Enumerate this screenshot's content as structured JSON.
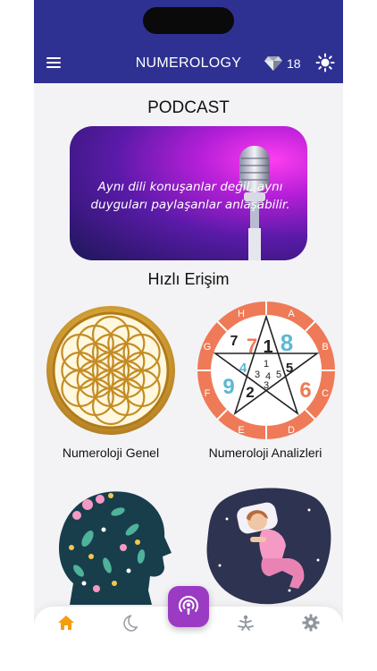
{
  "header": {
    "title": "NUMEROLOGY",
    "gem_count": "18"
  },
  "podcast": {
    "section_title": "PODCAST",
    "quote": "Aynı dili konuşanlar değil, aynı duyguları paylaşanlar anlaşabilir."
  },
  "quick_access": {
    "section_title": "Hızlı Erişim",
    "cards": [
      {
        "label": "Numeroloji Genel"
      },
      {
        "label": "Numeroloji Analizleri"
      },
      {
        "label": ""
      },
      {
        "label": ""
      }
    ]
  },
  "pentagram": {
    "outer_letters": [
      "H",
      "A",
      "B",
      "C",
      "D",
      "E",
      "F",
      "G"
    ],
    "big_digits": [
      "7",
      "1",
      "8",
      "4",
      "5",
      "9",
      "2",
      "6"
    ],
    "small_digits": [
      "1",
      "3",
      "4",
      "5",
      "3"
    ]
  },
  "bottom_nav": {
    "items": [
      "home-icon",
      "moon-icon",
      "podcast-icon",
      "meditation-icon",
      "gear-icon"
    ],
    "active": "home-icon"
  },
  "colors": {
    "header_bg": "#2e3192",
    "active_nav": "#f59e0b",
    "fab_bg": "#9b3bc3",
    "pentagram_ring": "#ef7a57"
  }
}
